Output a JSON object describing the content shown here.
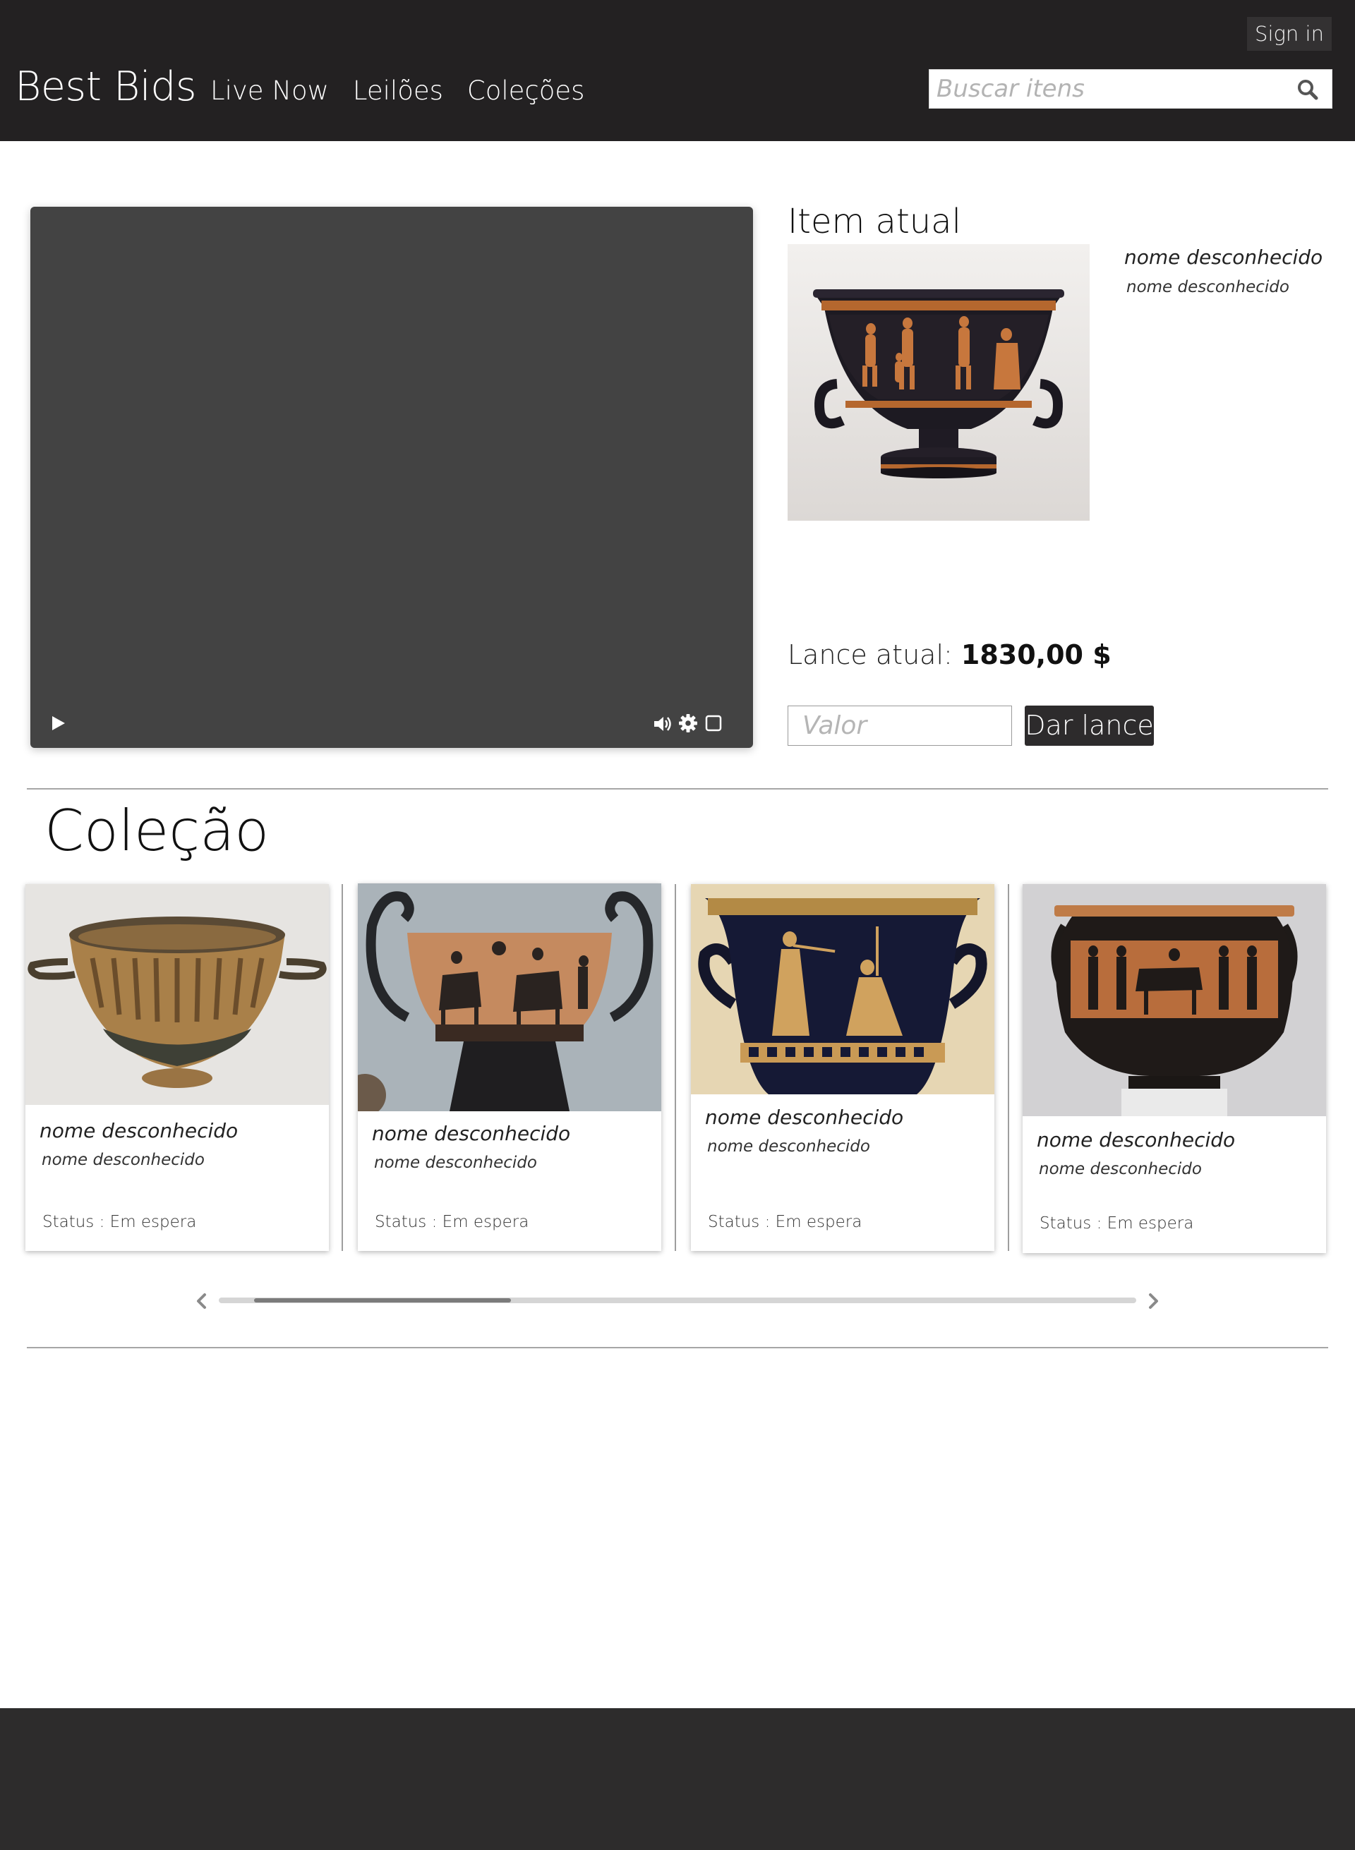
{
  "header": {
    "brand": "Best Bids",
    "signin_label": "Sign in",
    "nav": [
      {
        "label": "Live Now"
      },
      {
        "label": "Leilões"
      },
      {
        "label": "Coleções"
      }
    ],
    "search": {
      "placeholder": "Buscar itens",
      "value": ""
    }
  },
  "player": {
    "controls": [
      "play-icon",
      "volume-icon",
      "gear-icon",
      "fullscreen-icon"
    ]
  },
  "current_item": {
    "title": "Item atual",
    "name": "nome desconhecido",
    "subtitle": "nome desconhecido",
    "bid_label": "Lance atual:",
    "bid_value": "1830,00 $",
    "bid_input_placeholder": "Valor",
    "bid_button_label": "Dar lance"
  },
  "collection": {
    "title": "Coleção",
    "items": [
      {
        "name": "nome desconhecido",
        "subtitle": "nome desconhecido",
        "status": "Status : Em espera"
      },
      {
        "name": "nome desconhecido",
        "subtitle": "nome desconhecido",
        "status": "Status : Em espera"
      },
      {
        "name": "nome desconhecido",
        "subtitle": "nome desconhecido",
        "status": "Status : Em espera"
      },
      {
        "name": "nome desconhecido",
        "subtitle": "nome desconhecido",
        "status": "Status : Em espera"
      }
    ],
    "scroll_position": 0.28
  },
  "colors": {
    "header_bg": "#232122",
    "player_bg": "#434343",
    "button_bg": "#2d2b2c",
    "footer_bg": "#2d2c2c"
  }
}
